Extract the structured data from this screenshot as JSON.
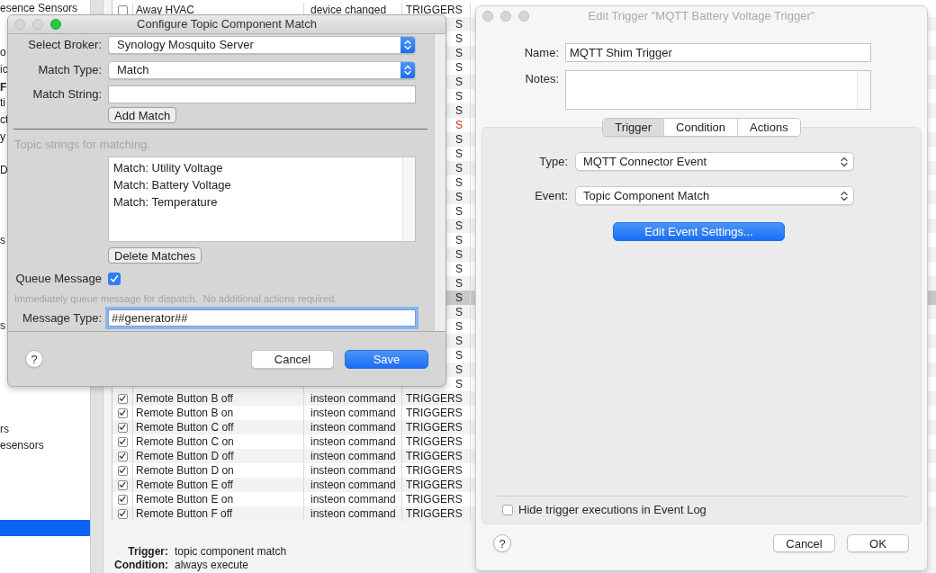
{
  "sidebar": {
    "items": [
      {
        "label": "esence Sensors",
        "kind": "item",
        "selected": false
      },
      {
        "label": "o",
        "kind": "item",
        "selected": false
      },
      {
        "label": "ic",
        "kind": "item",
        "selected": false
      },
      {
        "label": "F",
        "kind": "group",
        "selected": false
      },
      {
        "label": "ti",
        "kind": "item",
        "selected": false
      },
      {
        "label": "ct",
        "kind": "item",
        "selected": false
      },
      {
        "label": "y",
        "kind": "item",
        "selected": false
      },
      {
        "label": "D",
        "kind": "item",
        "selected": false
      },
      {
        "label": "s",
        "kind": "item",
        "selected": false
      },
      {
        "label": "s",
        "kind": "item",
        "selected": false
      },
      {
        "label": "rs",
        "kind": "item",
        "selected": false
      },
      {
        "label": "esensors",
        "kind": "item",
        "selected": false
      },
      {
        "kind": "item",
        "selected": true
      }
    ]
  },
  "table": {
    "rows": [
      {
        "selected": false,
        "checked": false,
        "column_2": "Away HVAC",
        "column_3": "device changed",
        "column_4": "TRIGGERS",
        "color": "#1e1e1e"
      },
      {
        "selected": false,
        "column_4": "S",
        "color": "#1e1e1e"
      },
      {
        "selected": false,
        "column_4": "S",
        "color": "#1e1e1e"
      },
      {
        "selected": false,
        "column_4": "S",
        "color": "#1e1e1e"
      },
      {
        "selected": false,
        "column_4": "S",
        "color": "#1e1e1e"
      },
      {
        "selected": false,
        "column_4": "S",
        "color": "#1e1e1e"
      },
      {
        "selected": false,
        "column_4": "S",
        "color": "#1e1e1e"
      },
      {
        "selected": false,
        "column_4": "S",
        "color": "#1e1e1e"
      },
      {
        "selected": false,
        "column_4": "S",
        "color": "#e0271f"
      },
      {
        "selected": false,
        "column_4": "S",
        "color": "#1e1e1e"
      },
      {
        "selected": false,
        "column_4": "S",
        "color": "#1e1e1e"
      },
      {
        "selected": false,
        "column_4": "S",
        "color": "#1e1e1e"
      },
      {
        "selected": false,
        "column_4": "S",
        "color": "#1e1e1e"
      },
      {
        "selected": false,
        "column_4": "S",
        "color": "#1e1e1e"
      },
      {
        "selected": false,
        "column_4": "S",
        "color": "#1e1e1e"
      },
      {
        "selected": false,
        "column_4": "S",
        "color": "#1e1e1e"
      },
      {
        "selected": false,
        "column_4": "S",
        "color": "#1e1e1e"
      },
      {
        "selected": false,
        "column_4": "S",
        "color": "#1e1e1e"
      },
      {
        "selected": false,
        "column_4": "S",
        "color": "#1e1e1e"
      },
      {
        "selected": false,
        "column_4": "S",
        "color": "#1e1e1e"
      },
      {
        "selected": true,
        "column_4": "S",
        "color": "#1e1e1e"
      },
      {
        "selected": false,
        "column_4": "S",
        "color": "#1e1e1e"
      },
      {
        "selected": false,
        "column_4": "S",
        "color": "#1e1e1e"
      },
      {
        "selected": false,
        "column_4": "S",
        "color": "#1e1e1e"
      },
      {
        "selected": false,
        "column_4": "S",
        "color": "#1e1e1e"
      },
      {
        "selected": false,
        "column_4": "S",
        "color": "#1e1e1e"
      },
      {
        "selected": false,
        "column_4": "S",
        "color": "#1e1e1e"
      },
      {
        "selected": false,
        "checked": true,
        "column_2": "Remote Button B off",
        "column_3": "insteon command",
        "column_4": "TRIGGERS",
        "color": "#1e1e1e"
      },
      {
        "selected": false,
        "checked": true,
        "column_2": "Remote Button B on",
        "column_3": "insteon command",
        "column_4": "TRIGGERS",
        "color": "#1e1e1e"
      },
      {
        "selected": false,
        "checked": true,
        "column_2": "Remote Button C off",
        "column_3": "insteon command",
        "column_4": "TRIGGERS",
        "color": "#1e1e1e"
      },
      {
        "selected": false,
        "checked": true,
        "column_2": "Remote Button C on",
        "column_3": "insteon command",
        "column_4": "TRIGGERS",
        "color": "#1e1e1e"
      },
      {
        "selected": false,
        "checked": true,
        "column_2": "Remote Button D off",
        "column_3": "insteon command",
        "column_4": "TRIGGERS",
        "color": "#1e1e1e"
      },
      {
        "selected": false,
        "checked": true,
        "column_2": "Remote Button D on",
        "column_3": "insteon command",
        "column_4": "TRIGGERS",
        "color": "#1e1e1e"
      },
      {
        "selected": false,
        "checked": true,
        "column_2": "Remote Button E off",
        "column_3": "insteon command",
        "column_4": "TRIGGERS",
        "color": "#1e1e1e"
      },
      {
        "selected": false,
        "checked": true,
        "column_2": "Remote Button E on",
        "column_3": "insteon command",
        "column_4": "TRIGGERS",
        "color": "#1e1e1e"
      },
      {
        "selected": false,
        "checked": true,
        "column_2": "Remote Button F off",
        "column_3": "insteon command",
        "column_4": "TRIGGERS",
        "color": "#1e1e1e"
      }
    ]
  },
  "details": [
    {
      "label": "Trigger:",
      "value": "topic component match"
    },
    {
      "label": "Condition:",
      "value": "always execute"
    }
  ],
  "topic_dialog": {
    "title": "Configure Topic Component Match",
    "active": true,
    "window_buttons": [
      {
        "enabled": false
      },
      {
        "enabled": false
      },
      {
        "enabled": true
      }
    ],
    "broker": {
      "label": "Select Broker:",
      "value": "Synology Mosquito Server"
    },
    "match_type": {
      "label": "Match Type:",
      "value": "Match"
    },
    "match_string": {
      "label": "Match String:"
    },
    "add_button": "Add Match",
    "list_caption": "Topic strings for matching.",
    "matches": [
      "Match: Utility Voltage",
      "Match: Battery Voltage",
      "Match: Temperature"
    ],
    "delete_button": "Delete Matches",
    "queue_message": {
      "label": "Queue Message",
      "checked": true
    },
    "queue_hint": "Immediately queue message for dispatch.  No additional actions required.",
    "message_type": {
      "label": "Message Type:",
      "value": "##generator##",
      "focused": true
    },
    "help": "?",
    "buttons": [
      {
        "label": "Cancel",
        "default": false
      },
      {
        "label": "Save",
        "default": true
      }
    ]
  },
  "trigger_dialog": {
    "title": "Edit Trigger \"MQTT Battery Voltage Trigger\"",
    "active": false,
    "window_buttons": [
      {
        "enabled": false
      },
      {
        "enabled": false
      },
      {
        "enabled": false
      }
    ],
    "name": {
      "label": "Name:",
      "value": "MQTT Shim Trigger"
    },
    "notes": {
      "label": "Notes:"
    },
    "tabs": [
      {
        "label": "Trigger",
        "selected": true
      },
      {
        "label": "Condition",
        "selected": false
      },
      {
        "label": "Actions",
        "selected": false
      }
    ],
    "type": {
      "label": "Type:",
      "value": "MQTT Connector Event"
    },
    "event": {
      "label": "Event:",
      "value": "Topic Component Match"
    },
    "edit_button": {
      "label": "Edit Event Settings...",
      "default": true
    },
    "hide_executions": {
      "label": "Hide trigger executions in Event Log",
      "checked": false
    },
    "help": "?",
    "buttons": [
      {
        "label": "Cancel",
        "default": false
      },
      {
        "label": "OK",
        "default": false
      }
    ]
  }
}
